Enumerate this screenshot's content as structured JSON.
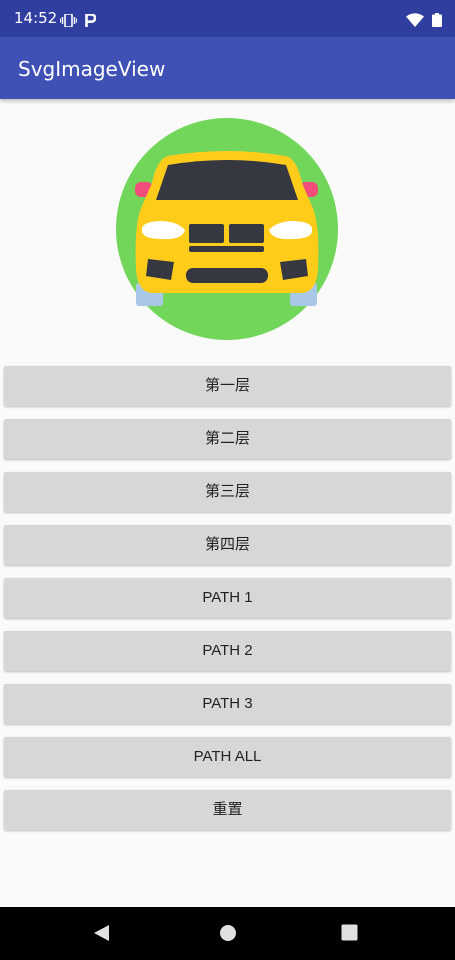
{
  "status_bar": {
    "time": "14:52",
    "left_icons": [
      "vibrate-icon",
      "parking-icon"
    ],
    "right_icons": [
      "wifi-icon",
      "battery-icon"
    ]
  },
  "app_bar": {
    "title": "SvgImageView",
    "color": "#3f51b5"
  },
  "image": {
    "icon": "car-icon",
    "colors": {
      "circle": "#72d65a",
      "body": "#ffcc1a",
      "dark": "#353741",
      "lights": "#ffffff",
      "mirrors": "#f24c7b",
      "wheels": "#a9c8e8"
    }
  },
  "buttons": [
    {
      "label": "第一层"
    },
    {
      "label": "第二层"
    },
    {
      "label": "第三层"
    },
    {
      "label": "第四层"
    },
    {
      "label": "PATH 1"
    },
    {
      "label": "PATH 2"
    },
    {
      "label": "PATH 3"
    },
    {
      "label": "PATH ALL"
    },
    {
      "label": "重置"
    }
  ],
  "nav_bar": {
    "icons": [
      "back-icon",
      "home-icon",
      "recents-icon"
    ]
  }
}
